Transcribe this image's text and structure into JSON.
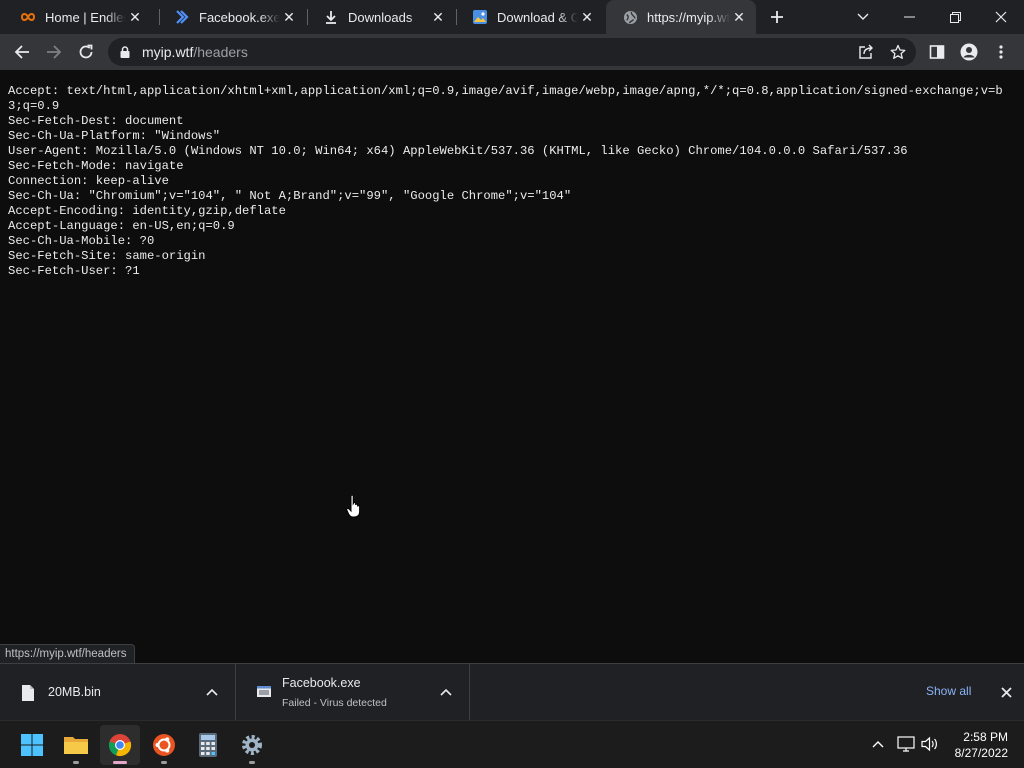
{
  "browser": {
    "tabs": [
      {
        "title": "Home | Endless",
        "icon": "endless-logo-icon",
        "active": false
      },
      {
        "title": "Facebook.exe - ...",
        "icon": "chevron-logo-icon",
        "active": false
      },
      {
        "title": "Downloads",
        "icon": "download-icon",
        "active": false
      },
      {
        "title": "Download & Ge...",
        "icon": "image-site-icon",
        "active": false
      },
      {
        "title": "https://myip.wtf/",
        "icon": "globe-icon",
        "active": true
      }
    ],
    "url_host": "myip.wtf",
    "url_path": "/headers"
  },
  "page": {
    "headers_text": "Accept: text/html,application/xhtml+xml,application/xml;q=0.9,image/avif,image/webp,image/apng,*/*;q=0.8,application/signed-exchange;v=b3;q=0.9\nSec-Fetch-Dest: document\nSec-Ch-Ua-Platform: \"Windows\"\nUser-Agent: Mozilla/5.0 (Windows NT 10.0; Win64; x64) AppleWebKit/537.36 (KHTML, like Gecko) Chrome/104.0.0.0 Safari/537.36\nSec-Fetch-Mode: navigate\nConnection: keep-alive\nSec-Ch-Ua: \"Chromium\";v=\"104\", \" Not A;Brand\";v=\"99\", \"Google Chrome\";v=\"104\"\nAccept-Encoding: identity,gzip,deflate\nAccept-Language: en-US,en;q=0.9\nSec-Ch-Ua-Mobile: ?0\nSec-Fetch-Site: same-origin\nSec-Fetch-User: ?1",
    "status_url": "https://myip.wtf/headers"
  },
  "downloads": {
    "items": [
      {
        "name": "20MB.bin",
        "status": ""
      },
      {
        "name": "Facebook.exe",
        "status": "Failed - Virus detected"
      }
    ],
    "show_all": "Show all"
  },
  "taskbar": {
    "apps": [
      "windows-start-icon",
      "file-explorer-icon",
      "chrome-icon",
      "ubuntu-icon",
      "calculator-icon",
      "settings-icon"
    ],
    "time": "2:58 PM",
    "date": "8/27/2022"
  },
  "colors": {
    "tab_strip": "#202124",
    "toolbar": "#35363a",
    "link_blue": "#8ab4f8",
    "page_bg": "#0d0d0d"
  }
}
